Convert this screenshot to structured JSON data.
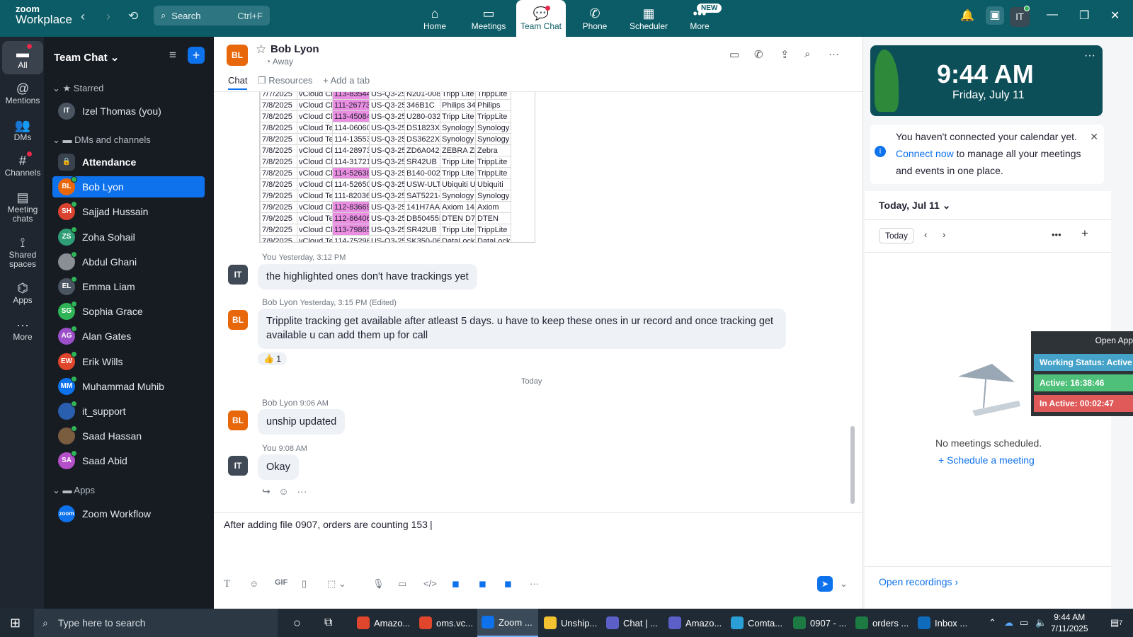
{
  "app": {
    "logo_line1": "zoom",
    "logo_line2": "Workplace",
    "search_label": "Search",
    "search_shortcut": "Ctrl+F",
    "tabs": [
      {
        "label": "Home",
        "icon": "home-icon"
      },
      {
        "label": "Meetings",
        "icon": "video-icon"
      },
      {
        "label": "Team Chat",
        "icon": "chat-icon"
      },
      {
        "label": "Phone",
        "icon": "phone-icon"
      },
      {
        "label": "Scheduler",
        "icon": "calendar-icon"
      },
      {
        "label": "More",
        "icon": "more-icon"
      }
    ],
    "new_badge": "NEW",
    "user_initials": "IT"
  },
  "rail": [
    {
      "label": "All",
      "icon": "chat-bubble-icon"
    },
    {
      "label": "Mentions",
      "icon": "at-icon"
    },
    {
      "label": "DMs",
      "icon": "people-icon"
    },
    {
      "label": "Channels",
      "icon": "hash-icon"
    },
    {
      "label": "Meeting chats",
      "icon": "calendar-chat-icon"
    },
    {
      "label": "Shared spaces",
      "icon": "shared-spaces-icon"
    },
    {
      "label": "Apps",
      "icon": "apps-icon"
    },
    {
      "label": "More",
      "icon": "more-icon"
    }
  ],
  "sidebar": {
    "title": "Team Chat",
    "sections": {
      "starred": "Starred",
      "dms": "DMs and channels",
      "apps": "Apps"
    },
    "starred": [
      {
        "name": "Izel Thomas (you)",
        "initials": "IT",
        "color": "#4a5561"
      }
    ],
    "items": [
      {
        "name": "Attendance",
        "initials": "",
        "color": "#3a424d"
      },
      {
        "name": "Bob Lyon",
        "initials": "BL",
        "color": "#e8670b"
      },
      {
        "name": "Sajjad Hussain",
        "initials": "SH",
        "color": "#d9432f"
      },
      {
        "name": "Zoha Sohail",
        "initials": "ZS",
        "color": "#2f9e77"
      },
      {
        "name": "Abdul Ghani",
        "initials": "",
        "color": "#8a8f95"
      },
      {
        "name": "Emma Liam",
        "initials": "EL",
        "color": "#4a5561"
      },
      {
        "name": "Sophia Grace",
        "initials": "SG",
        "color": "#2fb557"
      },
      {
        "name": "Alan Gates",
        "initials": "AG",
        "color": "#9b4fc9"
      },
      {
        "name": "Erik Wills",
        "initials": "EW",
        "color": "#e0462c"
      },
      {
        "name": "Muhammad Muhib",
        "initials": "MM",
        "color": "#0e72ed"
      },
      {
        "name": "it_support",
        "initials": "",
        "color": "#2a5fb0"
      },
      {
        "name": "Saad Hassan",
        "initials": "",
        "color": "#7a5c3f"
      },
      {
        "name": "Saad Abid",
        "initials": "SA",
        "color": "#b44fc9"
      }
    ],
    "apps": [
      {
        "name": "Zoom Workflow",
        "initials": "zoom",
        "color": "#0e72ed"
      }
    ]
  },
  "chat": {
    "contact_initials": "BL",
    "contact_name": "Bob Lyon",
    "contact_status": "Away",
    "tabs": [
      "Chat",
      "Resources",
      "Add a tab"
    ],
    "sheet_rows": [
      [
        "7/7/2025",
        "vCloud Ch",
        "113-83544",
        "US-Q3-25-",
        "N201-008-",
        "Tripp Lite",
        "TrippLite"
      ],
      [
        "7/8/2025",
        "vCloud Ch",
        "111-26773",
        "US-Q3-25-",
        "346B1C",
        "Philips 34",
        "Philips"
      ],
      [
        "7/8/2025",
        "vCloud Ch",
        "113-45084",
        "US-Q3-25-",
        "U280-032-",
        "Tripp Lite",
        "TrippLite"
      ],
      [
        "7/8/2025",
        "vCloud Te",
        "114-06060",
        "US-Q3-25-",
        "DS1823XS",
        "Synology 8",
        "Synology"
      ],
      [
        "7/8/2025",
        "vCloud Te",
        "114-13553",
        "US-Q3-25-",
        "DS3622XS",
        "Synology 1",
        "Synology"
      ],
      [
        "7/8/2025",
        "vCloud Ch",
        "114-28973",
        "US-Q3-25-",
        "ZD6A042-E",
        "ZEBRA ZD6",
        "Zebra"
      ],
      [
        "7/8/2025",
        "vCloud Ch",
        "114-31721",
        "US-Q3-25-",
        "SR42UB",
        "Tripp Lite",
        "TrippLite"
      ],
      [
        "7/8/2025",
        "vCloud Ch",
        "114-52638",
        "US-Q3-25-",
        "B140-002-",
        "Tripp Lite",
        "TrippLite"
      ],
      [
        "7/8/2025",
        "vCloud Ch",
        "114-52650",
        "US-Q3-25-",
        "USW-ULTR",
        "Ubiquiti U",
        "Ubiquiti"
      ],
      [
        "7/9/2025",
        "vCloud Te",
        "111-82036",
        "US-Q3-25-",
        "SAT5221-9",
        "Synology S",
        "Synology"
      ],
      [
        "7/9/2025",
        "vCloud Ch",
        "112-83669",
        "US-Q3-25-",
        "141H7AA-A",
        "Axiom 141",
        "Axiom"
      ],
      [
        "7/9/2025",
        "vCloud Te",
        "112-86406",
        "US-Q3-25-",
        "DB50455E",
        "DTEN D7 5",
        "DTEN"
      ],
      [
        "7/9/2025",
        "vCloud Ch",
        "113-79865",
        "US-Q3-25-",
        "SR42UB",
        "Tripp Lite",
        "TrippLite"
      ],
      [
        "7/9/2025",
        "vCloud Te",
        "114-75296",
        "US-Q3-25-",
        "SK350-064",
        "DataLocke",
        "DataLocke"
      ]
    ],
    "sheet_highlight_rows": [
      0,
      1,
      2,
      7,
      10,
      11,
      12
    ],
    "messages": [
      {
        "sender": "You",
        "time": "Yesterday, 3:12 PM",
        "text": "the highlighted ones don't have trackings yet",
        "initials": "IT"
      },
      {
        "sender": "Bob Lyon",
        "time": "Yesterday, 3:15 PM (Edited)",
        "text": "Tripplite tracking get available after atleast 5 days. u have to keep these ones in ur record and once tracking get available u can add them up for call",
        "initials": "BL"
      },
      {
        "sender": "Bob Lyon",
        "time": "9:06 AM",
        "text": "unship updated",
        "initials": "BL"
      },
      {
        "sender": "You",
        "time": "9:08 AM",
        "text": "Okay",
        "initials": "IT"
      }
    ],
    "reaction": "👍 1",
    "day_separator": "Today",
    "composer_text": "After adding file 0907, orders are counting 153"
  },
  "right": {
    "clock_time": "9:44 AM",
    "clock_date": "Friday, July 11",
    "cal_note_pre": "You haven't connected your calendar yet.",
    "cal_note_link": "Connect now",
    "cal_note_post": "to manage all your meetings and events in one place.",
    "today_header": "Today, Jul 11",
    "today_button": "Today",
    "no_meetings": "No meetings scheduled.",
    "schedule_link": "Schedule a meeting",
    "open_recordings": "Open recordings"
  },
  "overlay": {
    "open_app": "Open App",
    "working_status": "Working Status: Active",
    "active": "Active: 16:38:46",
    "inactive": "In Active: 00:02:47",
    "colors": {
      "working": "#45a3c9",
      "active": "#4fc07a",
      "inactive": "#e05a5a"
    }
  },
  "taskbar": {
    "search_placeholder": "Type here to search",
    "apps": [
      {
        "label": "Amazo...",
        "color": "#e0462c"
      },
      {
        "label": "oms.vc...",
        "color": "#e0462c"
      },
      {
        "label": "Zoom ...",
        "color": "#0e72ed"
      },
      {
        "label": "Unship...",
        "color": "#f2c230"
      },
      {
        "label": "Chat | ...",
        "color": "#5b5fc7"
      },
      {
        "label": "Amazo...",
        "color": "#5b5fc7"
      },
      {
        "label": "Comta...",
        "color": "#2a9fd6"
      },
      {
        "label": "0907 - ...",
        "color": "#1d7a43"
      },
      {
        "label": "orders ...",
        "color": "#1d7a43"
      },
      {
        "label": "Inbox ...",
        "color": "#0f6cbd"
      }
    ],
    "time": "9:44 AM",
    "date": "7/11/2025",
    "notif_count": "7"
  }
}
